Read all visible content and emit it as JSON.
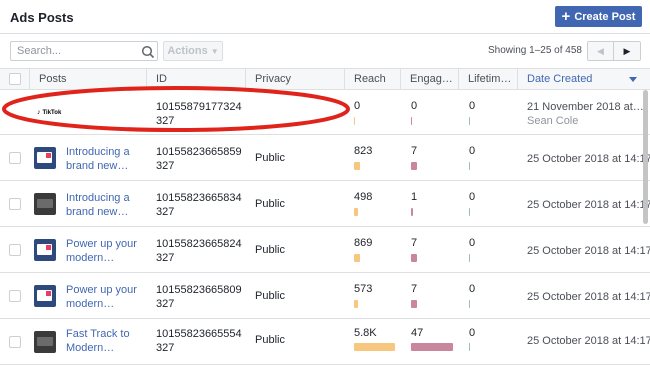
{
  "header": {
    "title": "Ads Posts",
    "create_button": {
      "icon": "plus-icon",
      "label": "Create Post"
    }
  },
  "toolbar": {
    "search_placeholder": "Search...",
    "search_icon": "search-icon",
    "actions_label": "Actions",
    "showing_text": "Showing 1–25 of 458",
    "pager": {
      "prev_icon": "chevron-left-icon",
      "next_icon": "chevron-right-icon"
    }
  },
  "columns": {
    "posts": "Posts",
    "id": "ID",
    "privacy": "Privacy",
    "reach": "Reach",
    "engagement": "Engag…",
    "lifetime": "Lifetim…",
    "date_created": "Date Created"
  },
  "rows": [
    {
      "thumb": "tiktok-logo",
      "brand": "TikTok",
      "title_line1": "",
      "title_line2": "",
      "id_line1": "10155879177324",
      "id_line2": "327",
      "privacy": "",
      "reach": "0",
      "engagement": "0",
      "lifetime": "0",
      "reach_fraction": 0,
      "engagement_fraction": 0,
      "date": "21 November 2018 at…",
      "author": "Sean Cole"
    },
    {
      "thumb": "blue-thumbnail",
      "title_line1": "Introducing a",
      "title_line2": "brand new…",
      "id_line1": "10155823665859",
      "id_line2": "327",
      "privacy": "Public",
      "reach": "823",
      "engagement": "7",
      "lifetime": "0",
      "reach_fraction": 0.14,
      "engagement_fraction": 0.15,
      "date": "25 October 2018 at 14:17",
      "author": ""
    },
    {
      "thumb": "dark-thumbnail",
      "title_line1": "Introducing a",
      "title_line2": "brand new…",
      "id_line1": "10155823665834",
      "id_line2": "327",
      "privacy": "Public",
      "reach": "498",
      "engagement": "1",
      "lifetime": "0",
      "reach_fraction": 0.09,
      "engagement_fraction": 0.02,
      "date": "25 October 2018 at 14:17",
      "author": ""
    },
    {
      "thumb": "blue-thumbnail",
      "title_line1": "Power up your",
      "title_line2": "modern…",
      "id_line1": "10155823665824",
      "id_line2": "327",
      "privacy": "Public",
      "reach": "869",
      "engagement": "7",
      "lifetime": "0",
      "reach_fraction": 0.15,
      "engagement_fraction": 0.15,
      "date": "25 October 2018 at 14:17",
      "author": ""
    },
    {
      "thumb": "blue-thumbnail",
      "title_line1": "Power up your",
      "title_line2": "modern…",
      "id_line1": "10155823665809",
      "id_line2": "327",
      "privacy": "Public",
      "reach": "573",
      "engagement": "7",
      "lifetime": "0",
      "reach_fraction": 0.1,
      "engagement_fraction": 0.15,
      "date": "25 October 2018 at 14:17",
      "author": ""
    },
    {
      "thumb": "dark-thumbnail",
      "title_line1": "Fast Track to",
      "title_line2": "Modern…",
      "id_line1": "10155823665554",
      "id_line2": "327",
      "privacy": "Public",
      "reach": "5.8K",
      "engagement": "47",
      "lifetime": "0",
      "reach_fraction": 1.0,
      "engagement_fraction": 1.0,
      "date": "25 October 2018 at 14:17",
      "author": ""
    }
  ],
  "colors": {
    "accent": "#4267b2",
    "reach_bar": "#f7c67f",
    "engagement_bar": "#c9879e",
    "highlight_ellipse": "#e0241b"
  }
}
